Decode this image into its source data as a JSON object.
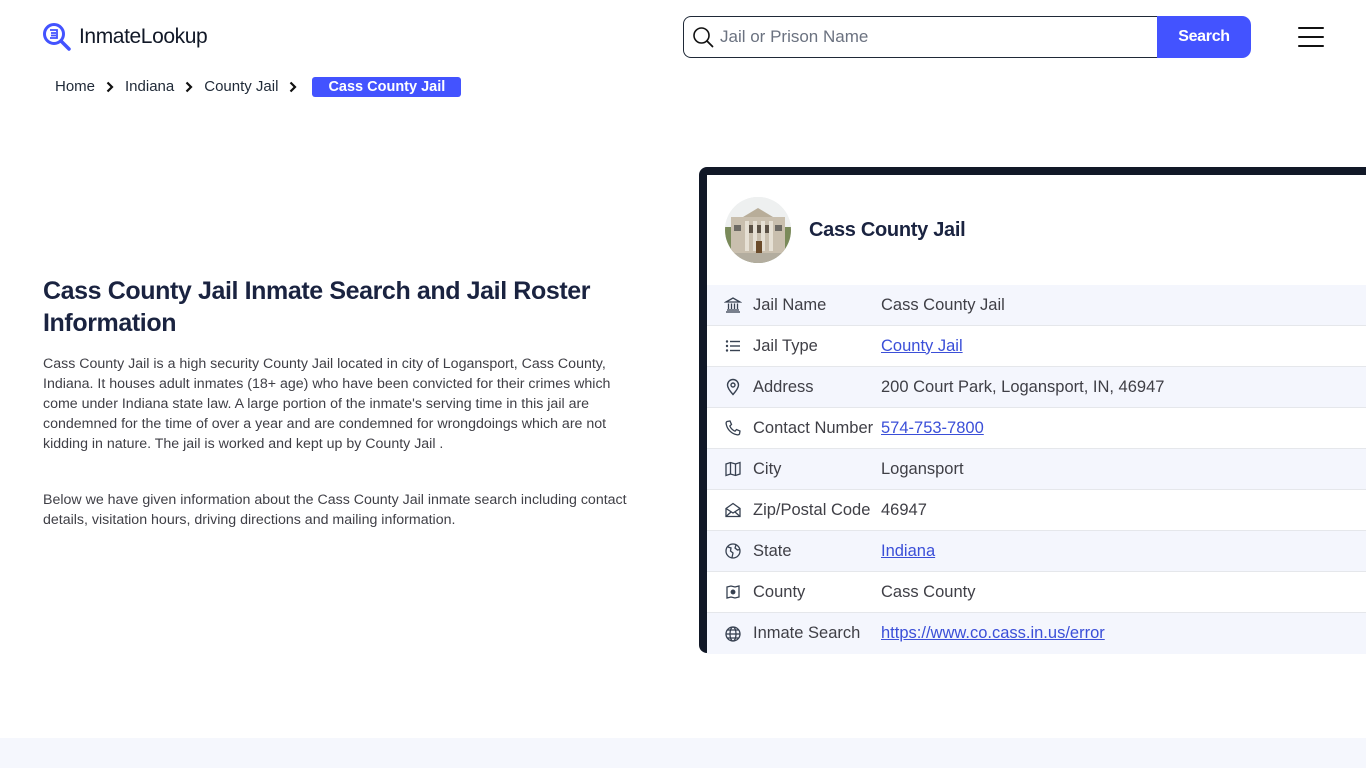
{
  "header": {
    "logo_text": "InmateLookup",
    "search": {
      "placeholder": "Jail or Prison Name",
      "value": "",
      "button_label": "Search"
    }
  },
  "breadcrumb": {
    "items": [
      "Home",
      "Indiana",
      "County Jail"
    ],
    "current": "Cass County Jail"
  },
  "main": {
    "title": "Cass County Jail Inmate Search and Jail Roster Information",
    "paragraphs": [
      "Cass County Jail is a high security County Jail located in city of Logansport, Cass County, Indiana. It houses adult inmates (18+ age) who have been convicted for their crimes which come under Indiana state law. A large portion of the inmate's serving time in this jail are condemned for the time of over a year and are condemned for wrongdoings which are not kidding in nature. The jail is worked and kept up by County Jail .",
      "Below we have given information about the Cass County Jail inmate search including contact details, visitation hours, driving directions and mailing information."
    ]
  },
  "card": {
    "title": "Cass County Jail",
    "rows": [
      {
        "icon": "building-columns-icon",
        "label": "Jail Name",
        "value": "Cass County Jail",
        "link": false
      },
      {
        "icon": "list-icon",
        "label": "Jail Type",
        "value": "County Jail",
        "link": true
      },
      {
        "icon": "map-pin-icon",
        "label": "Address",
        "value": "200 Court Park, Logansport, IN, 46947",
        "link": false
      },
      {
        "icon": "phone-icon",
        "label": "Contact Number",
        "value": "574-753-7800",
        "link": true
      },
      {
        "icon": "map-icon",
        "label": "City",
        "value": "Logansport",
        "link": false
      },
      {
        "icon": "mail-open-icon",
        "label": "Zip/Postal Code",
        "value": "46947",
        "link": false
      },
      {
        "icon": "globe-region-icon",
        "label": "State",
        "value": "Indiana",
        "link": true
      },
      {
        "icon": "county-map-icon",
        "label": "County",
        "value": "Cass County",
        "link": false
      },
      {
        "icon": "globe-icon",
        "label": "Inmate Search",
        "value": "https://www.co.cass.in.us/error",
        "link": true
      }
    ]
  },
  "colors": {
    "accent": "#4353ff",
    "card_border": "#111827",
    "link": "#3b4fd8",
    "row_alt": "#f4f6fd"
  }
}
